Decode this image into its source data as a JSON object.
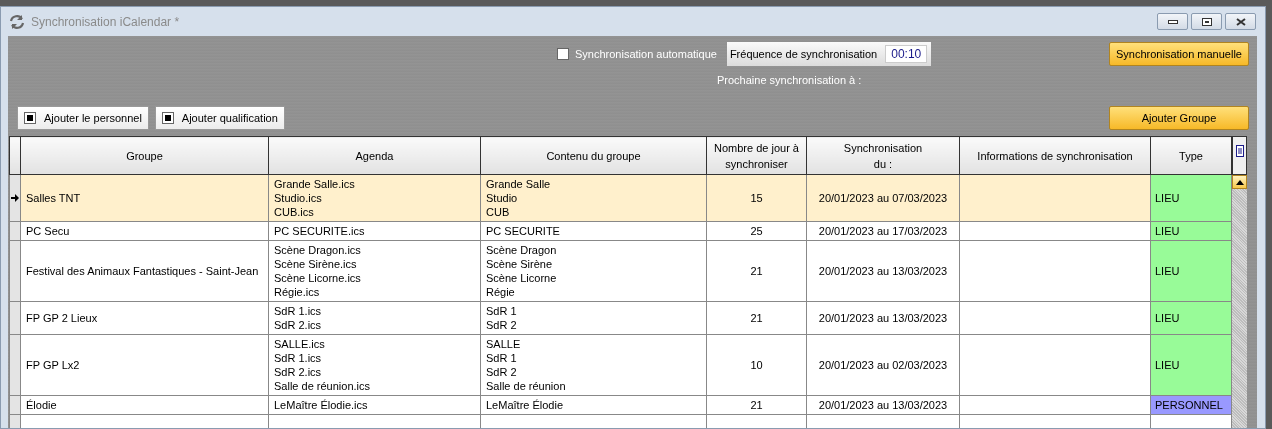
{
  "window": {
    "title": "Synchronisation iCalendar *"
  },
  "auto_sync": {
    "label": "Synchronisation automatique",
    "checked": false
  },
  "frequency": {
    "label": "Fréquence de synchronisation",
    "value": "00:10"
  },
  "next_sync": {
    "label": "Prochaine synchronisation à :"
  },
  "manual_button": "Synchronisation manuelle",
  "add_group_button": "Ajouter Groupe",
  "options": [
    {
      "label": "Ajouter le personnel",
      "checked": true
    },
    {
      "label": "Ajouter qualification",
      "checked": true
    }
  ],
  "table": {
    "columns": [
      "Groupe",
      "Agenda",
      "Contenu du groupe",
      "Nombre de jour à synchroniser",
      "Synchronisation du :",
      "Informations de synchronisation",
      "Type"
    ],
    "rows": [
      {
        "selected": true,
        "group": "Salles TNT",
        "agenda": [
          "Grande Salle.ics",
          "Studio.ics",
          "CUB.ics"
        ],
        "content": [
          "Grande Salle",
          "Studio",
          "CUB"
        ],
        "days": "15",
        "period": "20/01/2023 au 07/03/2023",
        "type": "LIEU",
        "color": "#98fb98"
      },
      {
        "selected": false,
        "group": "PC Secu",
        "agenda": [
          "PC SECURITE.ics"
        ],
        "content": [
          "PC SECURITE"
        ],
        "days": "25",
        "period": "20/01/2023 au 17/03/2023",
        "type": "LIEU",
        "color": "#98fb98"
      },
      {
        "selected": false,
        "group": "Festival des Animaux Fantastiques - Saint-Jean",
        "agenda": [
          "Scène Dragon.ics",
          "Scène Sirène.ics",
          "Scène Licorne.ics",
          "Régie.ics"
        ],
        "content": [
          "Scène Dragon",
          "Scène Sirène",
          "Scène Licorne",
          "Régie"
        ],
        "days": "21",
        "period": "20/01/2023 au 13/03/2023",
        "type": "LIEU",
        "color": "#98fb98"
      },
      {
        "selected": false,
        "group": "FP GP 2 Lieux",
        "agenda": [
          "SdR 1.ics",
          "SdR 2.ics"
        ],
        "content": [
          "SdR 1",
          "SdR 2"
        ],
        "days": "21",
        "period": "20/01/2023 au 13/03/2023",
        "type": "LIEU",
        "color": "#98fb98"
      },
      {
        "selected": false,
        "group": "FP GP Lx2",
        "agenda": [
          "SALLE.ics",
          "SdR 1.ics",
          "SdR 2.ics",
          "Salle de réunion.ics"
        ],
        "content": [
          "SALLE",
          "SdR 1",
          "SdR 2",
          "Salle de réunion"
        ],
        "days": "10",
        "period": "20/01/2023 au 02/03/2023",
        "type": "LIEU",
        "color": "#98fb98"
      },
      {
        "selected": false,
        "group": "Élodie",
        "agenda": [
          "LeMaître Élodie.ics"
        ],
        "content": [
          "LeMaître Élodie"
        ],
        "days": "21",
        "period": "20/01/2023 au 13/03/2023",
        "type": "PERSONNEL",
        "color": "#9999ff"
      }
    ]
  }
}
